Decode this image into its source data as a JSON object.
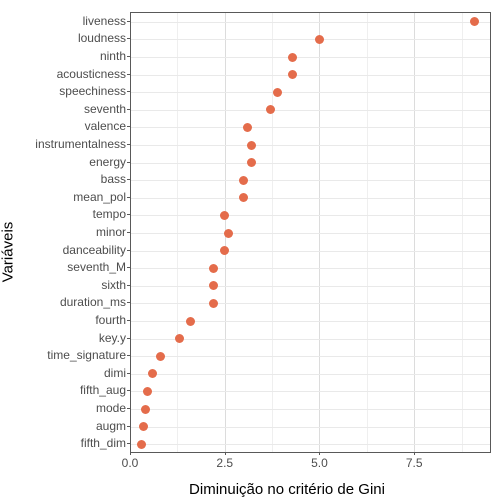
{
  "labels": {
    "ylabel": "Variáveis",
    "xlabel": "Diminuição no critério de Gini"
  },
  "chart_data": {
    "type": "scatter",
    "xlabel": "Diminuição no critério de Gini",
    "ylabel": "Variáveis",
    "xlim": [
      0,
      9.5
    ],
    "x_ticks": [
      0.0,
      2.5,
      5.0,
      7.5
    ],
    "categories": [
      "liveness",
      "loudness",
      "ninth",
      "acousticness",
      "speechiness",
      "seventh",
      "valence",
      "instrumentalness",
      "energy",
      "bass",
      "mean_pol",
      "tempo",
      "minor",
      "danceability",
      "seventh_M",
      "sixth",
      "duration_ms",
      "fourth",
      "key.y",
      "time_signature",
      "dimi",
      "fifth_aug",
      "mode",
      "augm",
      "fifth_dim"
    ],
    "values": [
      9.1,
      5.0,
      4.3,
      4.3,
      3.9,
      3.7,
      3.1,
      3.2,
      3.2,
      3.0,
      3.0,
      2.5,
      2.6,
      2.5,
      2.2,
      2.2,
      2.2,
      1.6,
      1.3,
      0.8,
      0.6,
      0.45,
      0.4,
      0.35,
      0.3
    ]
  }
}
